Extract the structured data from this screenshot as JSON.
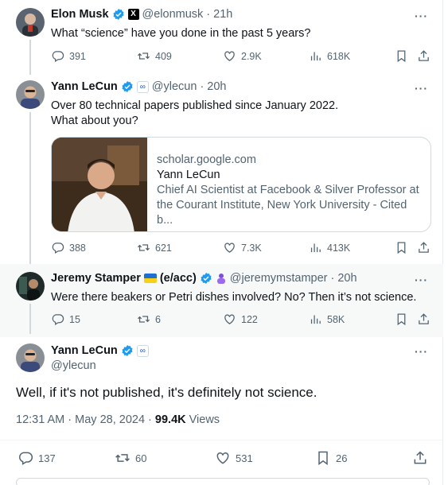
{
  "tweets": [
    {
      "name": "Elon Musk",
      "handle": "@elonmusk",
      "time": "· 21h",
      "text": "What “science” have you done in the past 5 years?",
      "replies": "391",
      "retweets": "409",
      "likes": "2.9K",
      "views": "618K"
    },
    {
      "name": "Yann LeCun",
      "handle": "@ylecun",
      "time": "· 20h",
      "text_line1": "Over 80 technical papers published since January 2022.",
      "text_line2": "What about you?",
      "card": {
        "domain": "scholar.google.com",
        "title": "Yann LeCun",
        "desc_line1": "Chief AI Scientist at Facebook & Silver Professor at",
        "desc_line2": "the Courant Institute, New York University - Cited b..."
      },
      "replies": "388",
      "retweets": "621",
      "likes": "7.3K",
      "views": "413K"
    },
    {
      "name": "Jeremy Stamper",
      "name_suffix": "(e/acc)",
      "handle": "@jeremymstamper",
      "time": "· 20h",
      "text": "Were there beakers or Petri dishes involved? No? Then it’s not science.",
      "replies": "15",
      "retweets": "6",
      "likes": "122",
      "views": "58K"
    },
    {
      "name": "Yann LeCun",
      "handle": "@ylecun",
      "text": "Well, if it's not published, it's definitely not science.",
      "timestamp": "12:31 AM · May 28, 2024 ·",
      "views_count": "99.4K",
      "views_label": "Views",
      "replies": "137",
      "retweets": "60",
      "likes": "531",
      "bookmarks": "26"
    }
  ],
  "more_label": "···",
  "colors": {
    "verified_blue": "#1d9bf0",
    "muted_text": "#536471",
    "border": "#cfd9de"
  }
}
